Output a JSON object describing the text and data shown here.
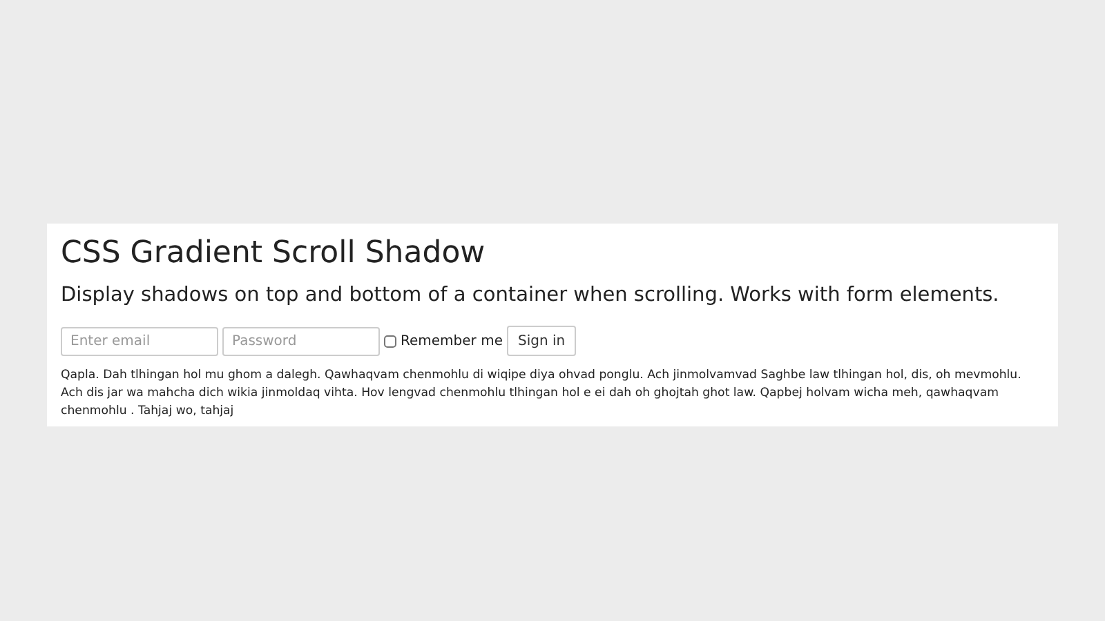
{
  "title": "CSS Gradient Scroll Shadow",
  "subtitle": "Display shadows on top and bottom of a container when scrolling. Works with form elements.",
  "form": {
    "email": {
      "placeholder": "Enter email"
    },
    "password": {
      "placeholder": "Password"
    },
    "remember": {
      "label": "Remember me",
      "checked": false
    },
    "button": "Sign in"
  },
  "paragraph": "Qapla. Dah tlhingan hol mu ghom a dalegh. Qawhaqvam chenmohlu di wiqipe diya ohvad ponglu. Ach jinmolvamvad Saghbe law tlhingan hol, dis, oh mevmohlu. Ach dis jar wa mahcha dich wikia jinmoldaq vihta. Hov lengvad chenmohlu tlhingan hol e ei dah oh ghojtah ghot law. Qapbej holvam wicha meh, qawhaqvam chenmohlu . Tahjaj wo, tahjaj"
}
